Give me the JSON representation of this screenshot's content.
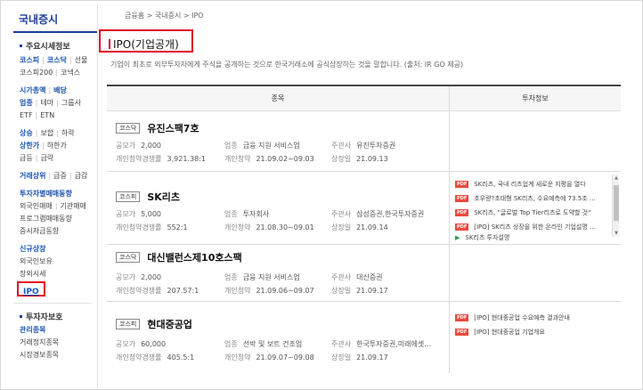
{
  "sidebar": {
    "title": "국내증시",
    "sections": [
      {
        "title": "주요시세정보",
        "rows": [
          [
            "코스피",
            "코스닥",
            "선물"
          ],
          [
            "코스피200",
            "코넥스"
          ]
        ]
      },
      {
        "title": null,
        "rows": [
          [
            "시가총액",
            "배당"
          ],
          [
            "업종",
            "테마",
            "그룹사"
          ],
          [
            "ETF",
            "ETN"
          ]
        ]
      },
      {
        "title": null,
        "rows": [
          [
            "상승",
            "보합",
            "하락"
          ],
          [
            "상한가",
            "하한가"
          ],
          [
            "급등",
            "급락"
          ]
        ]
      },
      {
        "title": null,
        "rows": [
          [
            "거래상위",
            "급증",
            "급감"
          ]
        ]
      },
      {
        "title": null,
        "rows": [
          [
            "투자자별매매동향"
          ],
          [
            "외국인매매",
            "기관매매"
          ],
          [
            "프로그램매매동향"
          ],
          [
            "증시자금동향"
          ]
        ]
      },
      {
        "title": null,
        "rows": [
          [
            "신규상장"
          ],
          [
            "외국인보유"
          ],
          [
            "장외시세"
          ]
        ]
      }
    ],
    "ipo_label": "IPO",
    "section2_title": "투자자보호",
    "section2_items": [
      "관리종목",
      "거래정지종목",
      "시장경보종목"
    ]
  },
  "breadcrumb": "금융홈 > 국내증시 > IPO",
  "page_title": "IPO(기업공개)",
  "description": "기업이 최초로 외부투자자에게 주식을 공개하는 것으로 한국거래소에 공식상장하는 것을 말합니다. (출처: IR GO 제공)",
  "table": {
    "col_left": "종목",
    "col_right": "투자정보",
    "labels": {
      "offer_price": "공모가",
      "demand_rate": "개인청약경쟁률",
      "industry": "업종",
      "sub_period": "개인청약",
      "underwriter": "주관사",
      "listing_date": "상장일"
    },
    "rows": [
      {
        "market": "코스닥",
        "name": "유진스팩7호",
        "offer_price": "2,000",
        "industry": "금융 지원 서비스업",
        "underwriter": "유진투자증권",
        "demand_rate": "3,921.38:1",
        "sub_period": "21.09.02~09.03",
        "listing_date": "21.09.13",
        "news": []
      },
      {
        "market": "코스피",
        "name": "SK리츠",
        "offer_price": "5,000",
        "industry": "투자회사",
        "underwriter": "삼성증권,한국투자증권",
        "demand_rate": "552:1",
        "sub_period": "21.08.30~09.01",
        "listing_date": "21.09.14",
        "news": [
          "SK리츠, 국내 리츠업계 새로운 지평을 열다",
          "초우량?초대형 SK리츠, 수요예측에 73.5조 …",
          "SK리츠, \"글로벌 Top Tier리츠로 도약할 것\"",
          "[IPO] SK리츠 상장을 위한 온라인 기업설명 …",
          "SK리츠 투자설명"
        ]
      },
      {
        "market": "코스닥",
        "name": "대신밸런스제10호스팩",
        "offer_price": "2,000",
        "industry": "금융 지원 서비스업",
        "underwriter": "대신증권",
        "demand_rate": "207.57:1",
        "sub_period": "21.09.06~09.07",
        "listing_date": "21.09.17",
        "news": []
      },
      {
        "market": "코스피",
        "name": "현대중공업",
        "offer_price": "60,000",
        "industry": "선박 및 보트 건조업",
        "underwriter": "한국투자증권,미래에셋…",
        "demand_rate": "405.5:1",
        "sub_period": "21.09.07~09.08",
        "listing_date": "21.09.17",
        "news": [
          "[IPO] 현대중공업 수요예측 결과안내",
          "[IPO] 현대중공업 기업개요"
        ]
      }
    ]
  }
}
